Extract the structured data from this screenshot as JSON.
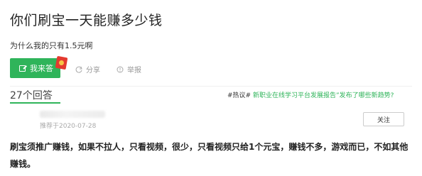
{
  "question": {
    "title": "你们刷宝一天能赚多少钱",
    "description": "为什么我的只有1.5元啊"
  },
  "actions": {
    "answer_label": "我来答",
    "share_label": "分享",
    "report_label": "举报"
  },
  "answers_header": {
    "count_label": "27个回答"
  },
  "hot_topic": {
    "tag": "#热议#",
    "text": "新职业在线学习平台发展报告”发布了哪些新趋势?"
  },
  "answer": {
    "meta": "推荐于2020-07-28",
    "follow_label": "关注",
    "content": "刷宝须推广赚钱，如果不拉人，只看视频，很少，只看视频只给1个元宝，赚钱不多，游戏而已，不如其他赚钱。"
  },
  "colors": {
    "accent": "#2fb45a",
    "redpacket": "#e43a2f"
  }
}
